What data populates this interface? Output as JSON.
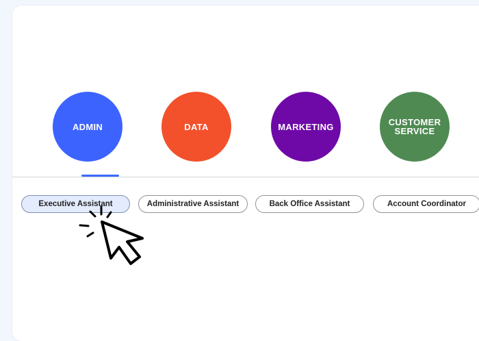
{
  "categories": [
    {
      "label": "ADMIN",
      "color": "#3d63ff"
    },
    {
      "label": "DATA",
      "color": "#f2512b"
    },
    {
      "label": "MARKETING",
      "color": "#6e09a8"
    },
    {
      "label": "CUSTOMER SERVICE",
      "color": "#4f8a52"
    }
  ],
  "active_category": "ADMIN",
  "roles": [
    {
      "label": "Executive Assistant",
      "selected": true
    },
    {
      "label": "Administrative Assistant",
      "selected": false
    },
    {
      "label": "Back Office Assistant",
      "selected": false
    },
    {
      "label": "Account Coordinator",
      "selected": false
    }
  ],
  "icons": {
    "pointer": "mouse-pointer-click-icon"
  },
  "colors": {
    "accent": "#3d6aff",
    "selected_pill_bg": "#e3ebfc",
    "page_bg": "#f2f7fd"
  }
}
